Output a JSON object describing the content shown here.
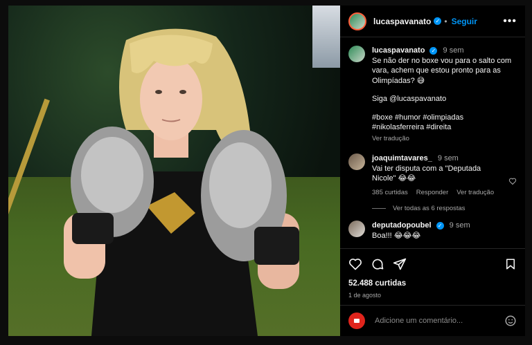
{
  "post": {
    "username": "lucaspavanato",
    "follow_label": "Seguir",
    "more_label": "•••"
  },
  "caption": {
    "username": "lucaspavanato",
    "time": "9 sem",
    "text": "Se não der no boxe vou para o salto com vara, achem que estou pronto para as Olimpíadas? 😅",
    "mention": "Siga @lucaspavanato",
    "hashtags": "#boxe #humor #olimpiadas #nikolasferreira #direita",
    "translate": "Ver tradução"
  },
  "comments": [
    {
      "username": "joaquimtavares_",
      "time": "9 sem",
      "text": "Vai ter disputa com a \"Deputada Nicole\" 😂😂",
      "likes": "385 curtidas",
      "reply": "Responder",
      "translate": "Ver tradução",
      "view_replies": "Ver todas as 6 respostas"
    },
    {
      "username": "deputadopoubel",
      "time": "9 sem",
      "text": "Boa!!! 😂😂😂"
    }
  ],
  "footer": {
    "likes": "52.488 curtidas",
    "date": "1 de agosto",
    "comment_placeholder": "Adicione um comentário..."
  },
  "icons": {
    "like": "heart-icon",
    "comment": "comment-icon",
    "share": "share-icon",
    "save": "bookmark-icon",
    "emoji": "emoji-icon"
  }
}
